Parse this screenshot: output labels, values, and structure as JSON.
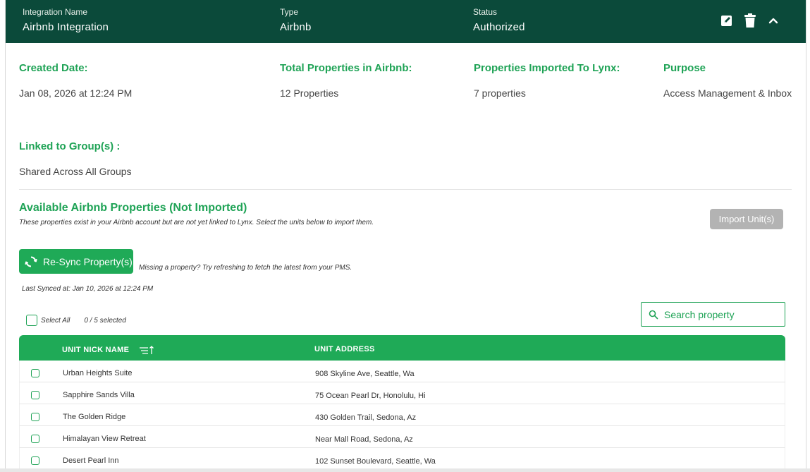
{
  "header": {
    "integration_name_label": "Integration Name",
    "integration_name_value": "Airbnb Integration",
    "type_label": "Type",
    "type_value": "Airbnb",
    "status_label": "Status",
    "status_value": "Authorized",
    "icons": [
      "edit-icon",
      "trash-icon",
      "chevron-up-icon"
    ],
    "bg_color": "#0b4a3a"
  },
  "details": {
    "created_date_label": "Created Date:",
    "created_date_value": "Jan 08, 2026 at 12:24 PM",
    "total_label": "Total Properties in Airbnb:",
    "total_value": "12 Properties",
    "imported_label": "Properties Imported To Lynx:",
    "imported_value": "7 properties",
    "purpose_label": "Purpose",
    "purpose_value": "Access Management & Inbox",
    "linked_label": "Linked to Group(s) :",
    "linked_value": "Shared Across All Groups"
  },
  "available": {
    "title": "Available Airbnb Properties (Not Imported)",
    "description": "These properties exist in your Airbnb account but are not yet linked to Lynx. Select the units below to import them.",
    "import_button": "Import Unit(s)",
    "resync_button": "Re-Sync Property(s)",
    "missing_note": "Missing a property? Try refreshing to fetch the latest from your PMS.",
    "last_synced": "Last Synced at: Jan 10, 2026 at 12:24 PM",
    "select_all_label": "Select All",
    "selected_count": "0 / 5 selected",
    "search_placeholder": "Search property"
  },
  "table": {
    "columns": [
      "UNIT NICK NAME",
      "UNIT ADDRESS"
    ],
    "rows": [
      {
        "name": "Urban Heights Suite",
        "address": "908 Skyline Ave, Seattle, Wa"
      },
      {
        "name": "Sapphire Sands Villa",
        "address": "75 Ocean Pearl Dr, Honolulu, Hi"
      },
      {
        "name": "The Golden Ridge",
        "address": "430 Golden Trail, Sedona, Az"
      },
      {
        "name": "Himalayan View Retreat",
        "address": "Near Mall Road, Sedona, Az"
      },
      {
        "name": "Desert Pearl Inn",
        "address": "102 Sunset Boulevard, Seattle, Wa"
      }
    ]
  },
  "colors": {
    "accent": "#1fa356",
    "header_bg": "#0b4a3a",
    "disabled_button": "#b3b3b3"
  }
}
